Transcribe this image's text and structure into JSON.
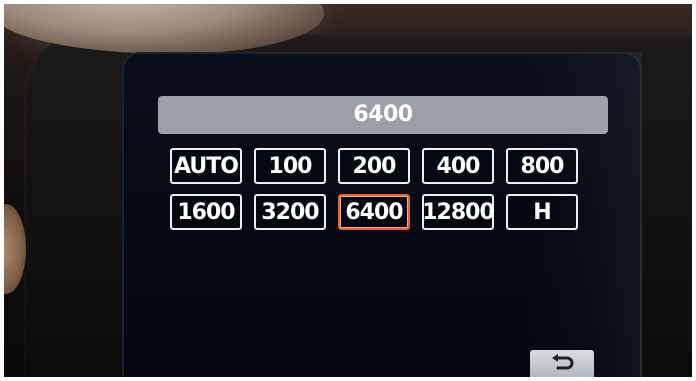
{
  "screen": {
    "title": "6400",
    "selected": "6400",
    "rows": [
      [
        "AUTO",
        "100",
        "200",
        "400",
        "800"
      ],
      [
        "1600",
        "3200",
        "6400",
        "12800",
        "H"
      ]
    ]
  },
  "icons": {
    "return": "return-icon"
  },
  "colors": {
    "selection_border": "#e8642a",
    "title_bar": "#9a9fa8",
    "screen_bg": "#060a13"
  }
}
